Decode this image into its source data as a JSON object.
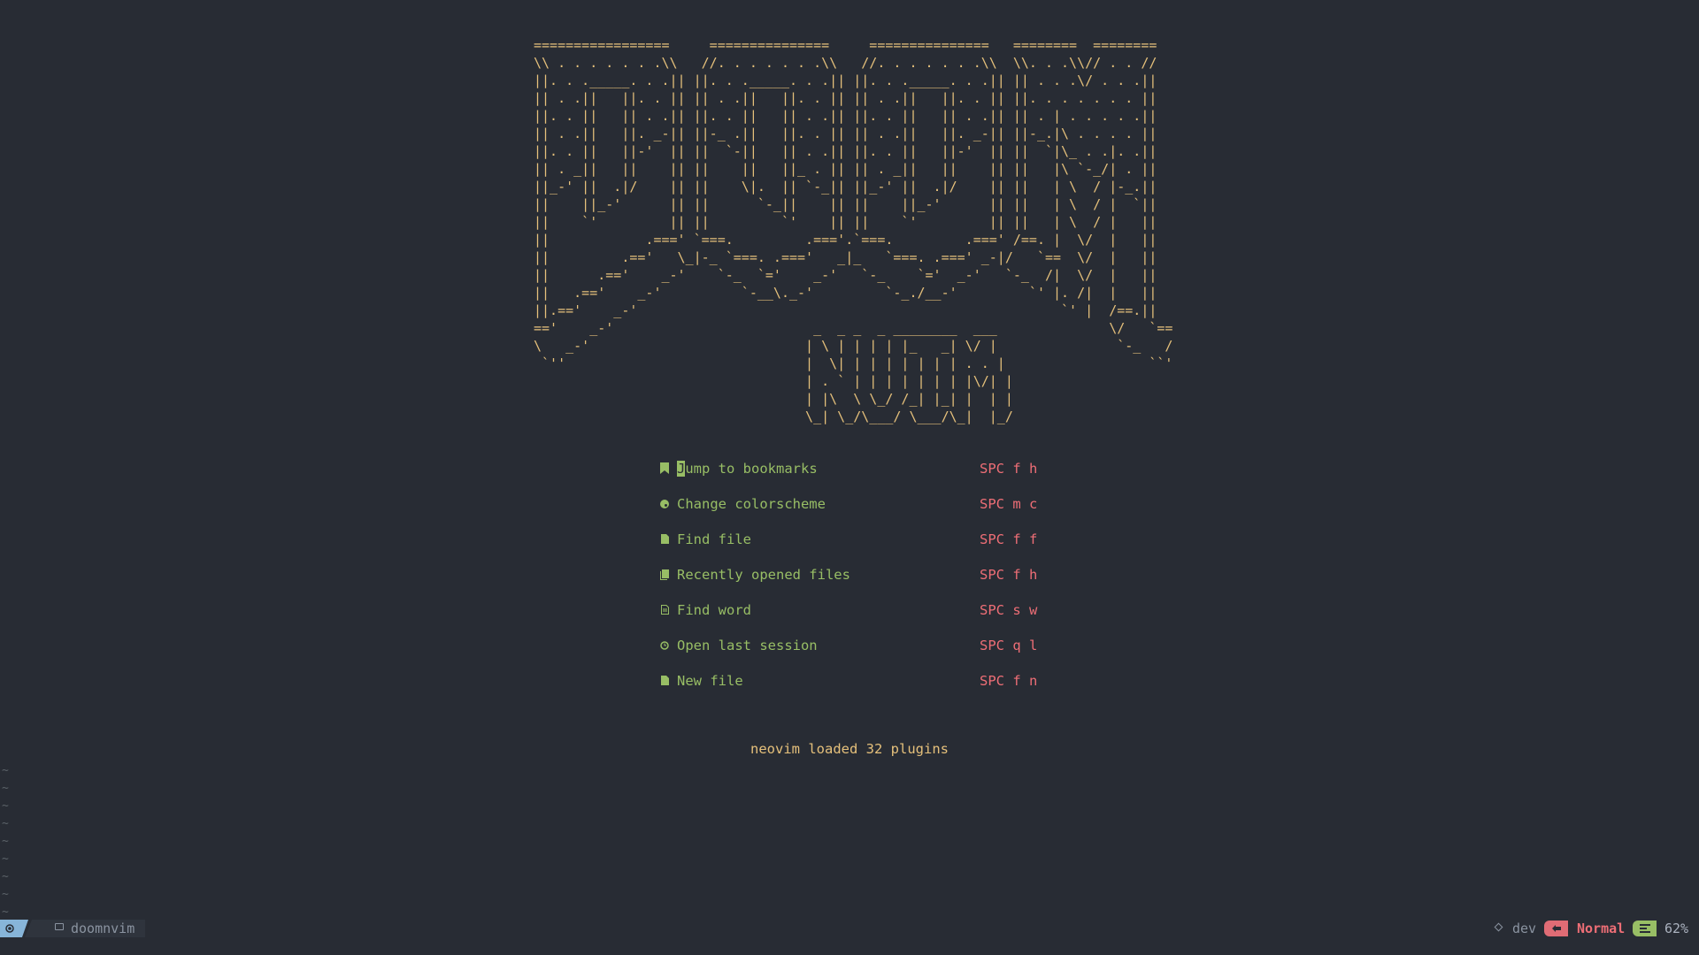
{
  "banner": {
    "ascii": "=================     ===============     ===============   ========  ========\n\\\\ . . . . . . .\\\\   //. . . . . . .\\\\   //. . . . . . .\\\\  \\\\. . .\\\\// . . //\n||. . ._____. . .|| ||. . ._____. . .|| ||. . ._____. . .|| || . . .\\/ . . .||\n|| . .||   ||. . || || . .||   ||. . || || . .||   ||. . || ||. . . . . . . ||\n||. . ||   || . .|| ||. . ||   || . .|| ||. . ||   || . .|| || . | . . . . .||\n|| . .||   ||. _-|| ||-_ .||   ||. . || || . .||   ||. _-|| ||-_.|\\ . . . . ||\n||. . ||   ||-'  || ||  `-||   || . .|| ||. . ||   ||-'  || ||  `|\\_ . .|. .||\n|| . _||   ||    || ||    ||   ||_ . || || . _||   ||    || ||   |\\ `-_/| . ||\n||_-' ||  .|/    || ||    \\|.  || `-_|| ||_-' ||  .|/    || ||   | \\  / |-_.||\n||    ||_-'      || ||      `-_||    || ||    ||_-'      || ||   | \\  / |  `||\n||    `'         || ||         `'    || ||    `'         || ||   | \\  / |   ||\n||            .===' `===.         .==='.`===.         .===' /==. |  \\/  |   ||\n||         .=='   \\_|-_ `===. .==='   _|_   `===. .===' _-|/   `==  \\/  |   ||\n||      .=='    _-'    `-_  `='    _-'   `-_    `='  _-'   `-_  /|  \\/  |   ||\n||   .=='    _-'          `-__\\._-'         `-_./__-'         `' |. /|  |   ||\n||.=='    _-'                                                     `' |  /==.||\n=='    _-'                         _  _ _  _ ________  ___              \\/   `==\n\\   _-'                           | \\ | | | | |_   _| \\/ |               `-_   /\n `''                              |  \\| | | | | | | | . . |                  ``'\n                                  | . ` | | | | | | | |\\/| |\n                                  | |\\  \\ \\_/ /_| |_| |  | |\n                                  \\_| \\_/\\___/ \\___/\\_|  |_/"
  },
  "menu": [
    {
      "icon": "bookmark-icon",
      "label": "Jump to bookmarks",
      "key": "SPC f h"
    },
    {
      "icon": "palette-icon",
      "label": "Change colorscheme",
      "key": "SPC m c"
    },
    {
      "icon": "file-icon",
      "label": "Find file",
      "key": "SPC f f"
    },
    {
      "icon": "files-icon",
      "label": "Recently opened files",
      "key": "SPC f h"
    },
    {
      "icon": "file-search-icon",
      "label": "Find word",
      "key": "SPC s w"
    },
    {
      "icon": "history-icon",
      "label": "Open last session",
      "key": "SPC q l"
    },
    {
      "icon": "new-file-icon",
      "label": "New file",
      "key": "SPC f n"
    }
  ],
  "footer": {
    "message": "neovim loaded 32 plugins"
  },
  "tildes": [
    "~",
    "~",
    "~",
    "~",
    "~",
    "~",
    "~",
    "~",
    "~"
  ],
  "statusline": {
    "folder": "doomnvim",
    "branch": "dev",
    "mode": "Normal",
    "position": "62%"
  },
  "colors": {
    "background": "#282c34",
    "accent_green": "#98be65",
    "accent_red": "#ee6e76",
    "banner_yellow": "#e5c07b",
    "mode_blue": "#87b5d9"
  }
}
